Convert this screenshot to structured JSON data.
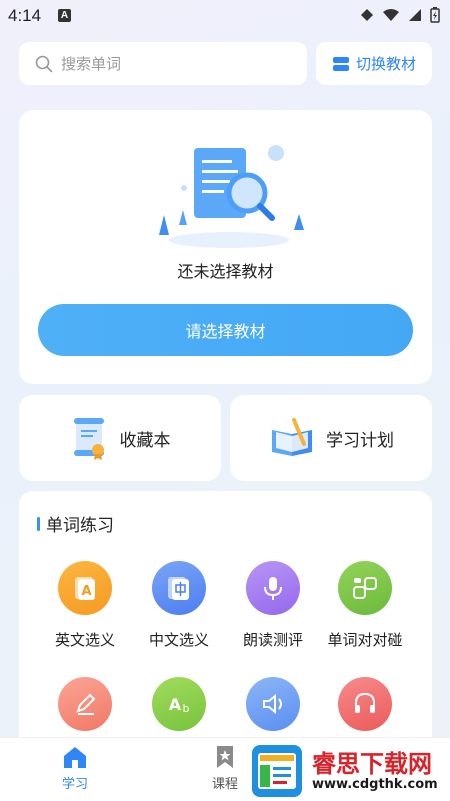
{
  "status_bar": {
    "time": "4:14",
    "notification_letter": "A"
  },
  "search": {
    "placeholder": "搜索单词"
  },
  "switch_button": {
    "label": "切换教材"
  },
  "empty_state": {
    "message": "还未选择教材",
    "button_label": "请选择教材"
  },
  "shortcuts": [
    {
      "label": "收藏本",
      "icon": "scroll-certificate-icon"
    },
    {
      "label": "学习计划",
      "icon": "open-book-pencil-icon"
    }
  ],
  "practice": {
    "title": "单词练习",
    "items": [
      {
        "label": "英文选义",
        "icon": "letter-a-card-icon",
        "color": "#f7a52d"
      },
      {
        "label": "中文选义",
        "icon": "chinese-card-icon",
        "color": "#5f8ff3"
      },
      {
        "label": "朗读测评",
        "icon": "microphone-icon",
        "color": "#a57ff0"
      },
      {
        "label": "单词对对碰",
        "icon": "match-blocks-icon",
        "color": "#7cc84a"
      },
      {
        "label": "",
        "icon": "pencil-icon",
        "color": "#f58a7b"
      },
      {
        "label": "",
        "icon": "ab-letters-icon",
        "color": "#8fd04a"
      },
      {
        "label": "",
        "icon": "speaker-icon",
        "color": "#6ea3f3"
      },
      {
        "label": "",
        "icon": "headphones-icon",
        "color": "#f26b6b"
      }
    ]
  },
  "nav": {
    "items": [
      {
        "label": "学习",
        "icon": "home-icon",
        "active": true
      },
      {
        "label": "课程",
        "icon": "bookmark-icon",
        "active": false
      }
    ]
  },
  "watermark": {
    "brand": "睿思下载网",
    "url": "www.cdgthk.com"
  },
  "colors": {
    "accent": "#2f86f6",
    "button": "#4aacf6"
  }
}
